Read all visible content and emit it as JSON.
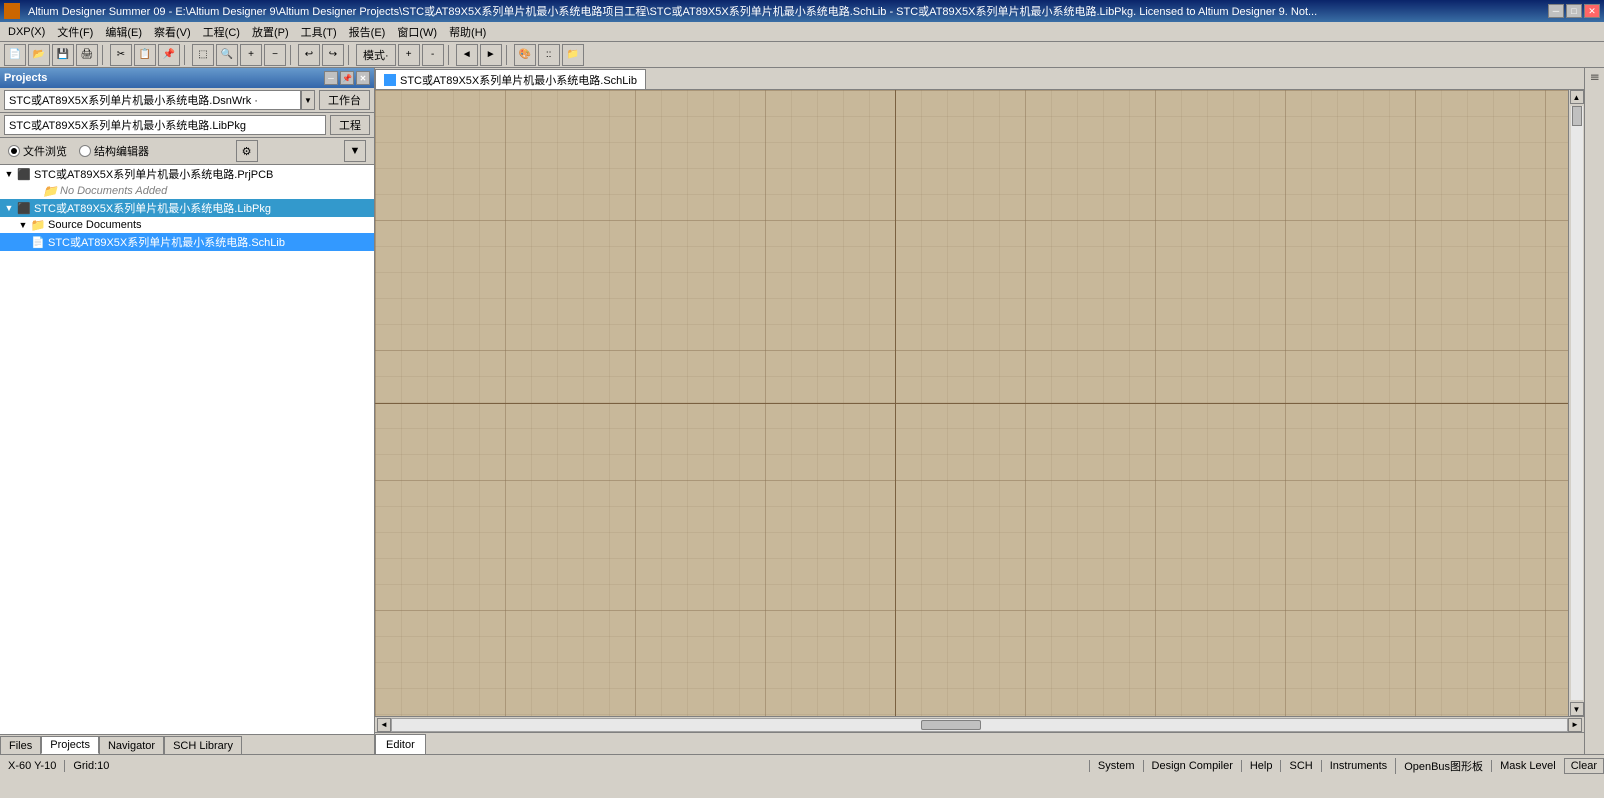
{
  "title_bar": {
    "text": "Altium Designer Summer 09 - E:\\Altium Designer 9\\Altium Designer Projects\\STC或AT89X5X系列单片机最小系统电路项目工程\\STC或AT89X5X系列单片机最小系统电路.SchLib - STC或AT89X5X系列单片机最小系统电路.LibPkg. Licensed to Altium Designer 9. Not...",
    "win_min": "─",
    "win_max": "□",
    "win_close": "✕"
  },
  "menu": {
    "items": [
      "DXP(X)",
      "文件(F)",
      "编辑(E)",
      "察看(V)",
      "工程(C)",
      "放置(P)",
      "工具(T)",
      "报告(E)",
      "窗口(W)",
      "帮助(H)"
    ]
  },
  "toolbar": {
    "mode_label": "模式·",
    "plus": "+",
    "minus": "-"
  },
  "projects_panel": {
    "title": "Projects",
    "pin_btn": "📌",
    "close_btn": "✕",
    "dropdown_value": "STC或AT89X5X系列单片机最小系统电路.DsnWrk ·",
    "workbench_btn": "工作台",
    "lib_pkg_value": "STC或AT89X5X系列单片机最小系统电路.LibPkg",
    "project_btn": "工程",
    "radio_file": "文件浏览",
    "radio_struct": "结构编辑器",
    "tree": {
      "items": [
        {
          "id": "prjpcb",
          "indent": 0,
          "label": "STC或AT89X5X系列单片机最小系统电路.PrjPCB",
          "expanded": true,
          "icon": "project",
          "children": [
            {
              "id": "no-docs",
              "indent": 1,
              "label": "No Documents Added",
              "icon": "folder",
              "expanded": false,
              "children": []
            }
          ]
        },
        {
          "id": "libpkg",
          "indent": 0,
          "label": "STC或AT89X5X系列单片机最小系统电路.LibPkg",
          "expanded": true,
          "icon": "project",
          "selected": true,
          "children": [
            {
              "id": "source-docs",
              "indent": 1,
              "label": "Source Documents",
              "icon": "folder",
              "expanded": true,
              "children": [
                {
                  "id": "schlib",
                  "indent": 2,
                  "label": "STC或AT89X5X系列单片机最小系统电路.SchLib",
                  "icon": "file",
                  "selected": true,
                  "children": []
                }
              ]
            }
          ]
        }
      ]
    }
  },
  "panel_tabs": {
    "items": [
      "Files",
      "Projects",
      "Navigator",
      "SCH Library"
    ],
    "active": "Projects"
  },
  "editor": {
    "tab_label": "STC或AT89X5X系列单片机最小系统电路.SchLib",
    "bottom_tab": "Editor"
  },
  "status_bar": {
    "coords": "X-60 Y-10",
    "grid": "Grid:10",
    "system": "System",
    "design_compiler": "Design Compiler",
    "help": "Help",
    "sch": "SCH",
    "instruments": "Instruments",
    "open_bus": "OpenBus图形板",
    "mask_level": "Mask Level",
    "clear": "Clear"
  },
  "right_edge": {
    "top_arrow": "▲",
    "scroll_indicator": "|||",
    "bottom_arrow": "▼"
  }
}
